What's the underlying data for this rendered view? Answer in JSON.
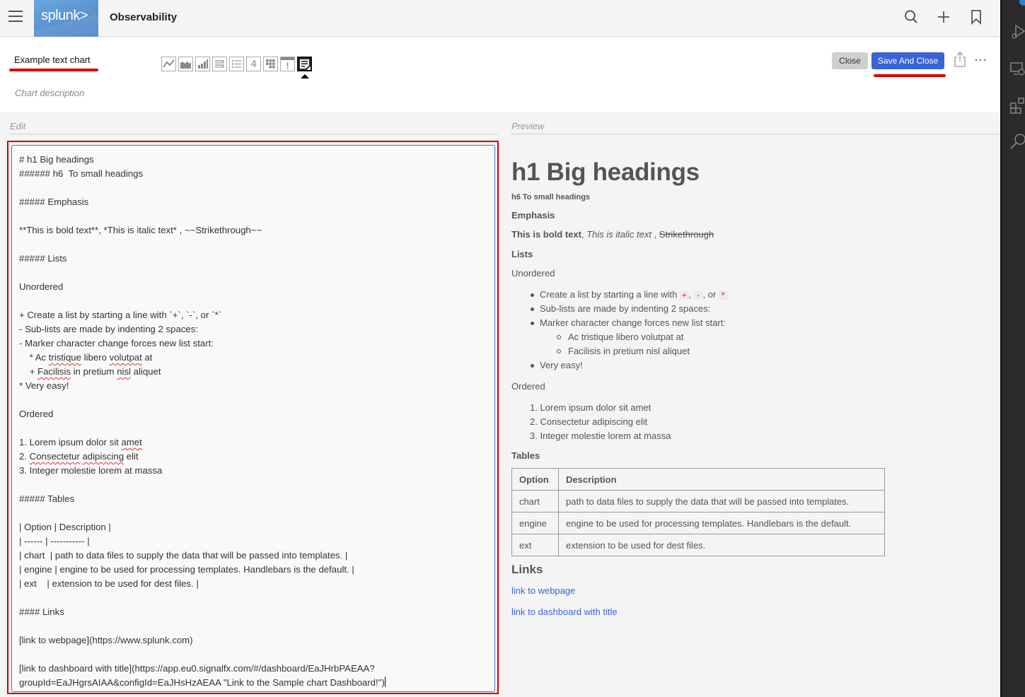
{
  "topbar": {
    "logo_text": "splunk>",
    "app_title": "Observability",
    "icons": [
      "menu-icon",
      "search-icon",
      "plus-icon",
      "bookmark-icon"
    ]
  },
  "header": {
    "chart_title": "Example text chart",
    "chart_description_placeholder": "Chart description",
    "chart_types": [
      {
        "name": "line-chart-icon",
        "active": false
      },
      {
        "name": "area-chart-icon",
        "active": false
      },
      {
        "name": "column-chart-icon",
        "active": false
      },
      {
        "name": "histogram-icon",
        "active": false
      },
      {
        "name": "list-icon",
        "active": false
      },
      {
        "name": "single-value-icon",
        "label": "4",
        "active": false
      },
      {
        "name": "heatmap-icon",
        "active": false
      },
      {
        "name": "event-feed-icon",
        "label": "!",
        "active": false
      },
      {
        "name": "text-icon",
        "active": true
      }
    ],
    "close_label": "Close",
    "save_label": "Save And Close",
    "accent_color": "#3a64d6",
    "annotation_color": "#e00000"
  },
  "edit": {
    "label": "Edit",
    "lines": [
      "# h1 Big headings",
      "###### h6  To small headings",
      "",
      "##### Emphasis",
      "",
      "**This is bold text**, *This is italic text* , ~~Strikethrough~~",
      "",
      "##### Lists",
      "",
      "Unordered",
      "",
      "+ Create a list by starting a line with `+`, `-`, or `*`",
      "- Sub-lists are made by indenting 2 spaces:",
      "- Marker character change forces new list start:",
      "    * Ac tristique libero volutpat at",
      "    + Facilisis in pretium nisl aliquet",
      "* Very easy!",
      "",
      "Ordered",
      "",
      "1. Lorem ipsum dolor sit amet",
      "2. Consectetur adipiscing elit",
      "3. Integer molestie lorem at massa",
      "",
      "##### Tables",
      "",
      "| Option | Description |",
      "| ------ | ----------- |",
      "| chart  | path to data files to supply the data that will be passed into templates. |",
      "| engine | engine to be used for processing templates. Handlebars is the default. |",
      "| ext    | extension to be used for dest files. |",
      "",
      "#### Links",
      "",
      "[link to webpage](https://www.splunk.com)",
      "",
      "[link to dashboard with title](https://app.eu0.signalfx.com/#/dashboard/EaJHrbPAEAA?",
      "groupId=EaJHgrsAIAA&configId=EaJHsHzAEAA \"Link to the Sample chart Dashboard!\")"
    ]
  },
  "preview": {
    "label": "Preview",
    "h1": "h1 Big headings",
    "h6": "h6 To small headings",
    "emphasis_heading": "Emphasis",
    "bold": "This is bold text",
    "sep1": ", ",
    "italic": "This is italic text",
    "sep2": " , ",
    "strike": "Strikethrough",
    "lists_heading": "Lists",
    "unordered_label": "Unordered",
    "unordered": {
      "item1_prefix": "Create a list by starting a line with",
      "code_plus": "+",
      "code_minus": "-",
      "code_star": "*",
      "or": ", or",
      "item2": "Sub-lists are made by indenting 2 spaces:",
      "item3": "Marker character change forces new list start:",
      "sub1": "Ac tristique libero volutpat at",
      "sub2": "Facilisis in pretium nisl aliquet",
      "item4": "Very easy!"
    },
    "ordered_label": "Ordered",
    "ordered": [
      "1. Lorem ipsum dolor sit amet",
      "2. Consectetur adipiscing elit",
      "3. Integer molestie lorem at massa"
    ],
    "tables_heading": "Tables",
    "table": {
      "headers": [
        "Option",
        "Description"
      ],
      "rows": [
        [
          "chart",
          "path to data files to supply the data that will be passed into templates."
        ],
        [
          "engine",
          "engine to be used for processing templates. Handlebars is the default."
        ],
        [
          "ext",
          "extension to be used for dest files."
        ]
      ]
    },
    "links_heading": "Links",
    "links": [
      "link to webpage",
      "link to dashboard with title"
    ],
    "link_color": "#3a64d6"
  }
}
